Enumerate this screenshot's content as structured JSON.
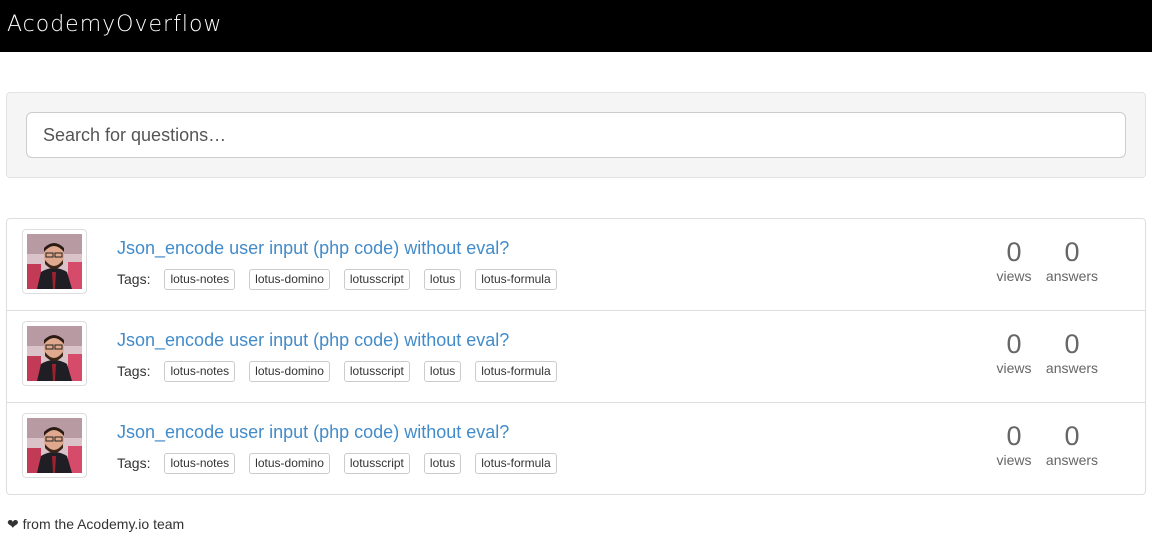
{
  "header": {
    "brand": "AcodemyOverflow"
  },
  "search": {
    "placeholder": "Search for questions…"
  },
  "questions": [
    {
      "title": "Json_encode user input (php code) without eval?",
      "tags_label": "Tags:",
      "tags": [
        "lotus-notes",
        "lotus-domino",
        "lotusscript",
        "lotus",
        "lotus-formula"
      ],
      "views": "0",
      "views_label": "views",
      "answers": "0",
      "answers_label": "answers"
    },
    {
      "title": "Json_encode user input (php code) without eval?",
      "tags_label": "Tags:",
      "tags": [
        "lotus-notes",
        "lotus-domino",
        "lotusscript",
        "lotus",
        "lotus-formula"
      ],
      "views": "0",
      "views_label": "views",
      "answers": "0",
      "answers_label": "answers"
    },
    {
      "title": "Json_encode user input (php code) without eval?",
      "tags_label": "Tags:",
      "tags": [
        "lotus-notes",
        "lotus-domino",
        "lotusscript",
        "lotus",
        "lotus-formula"
      ],
      "views": "0",
      "views_label": "views",
      "answers": "0",
      "answers_label": "answers"
    }
  ],
  "footer": {
    "icon": "heart-icon",
    "text": " from the Acodemy.io team"
  },
  "colors": {
    "navbar": "#000000",
    "link": "#428bca",
    "well": "#f5f5f5"
  }
}
